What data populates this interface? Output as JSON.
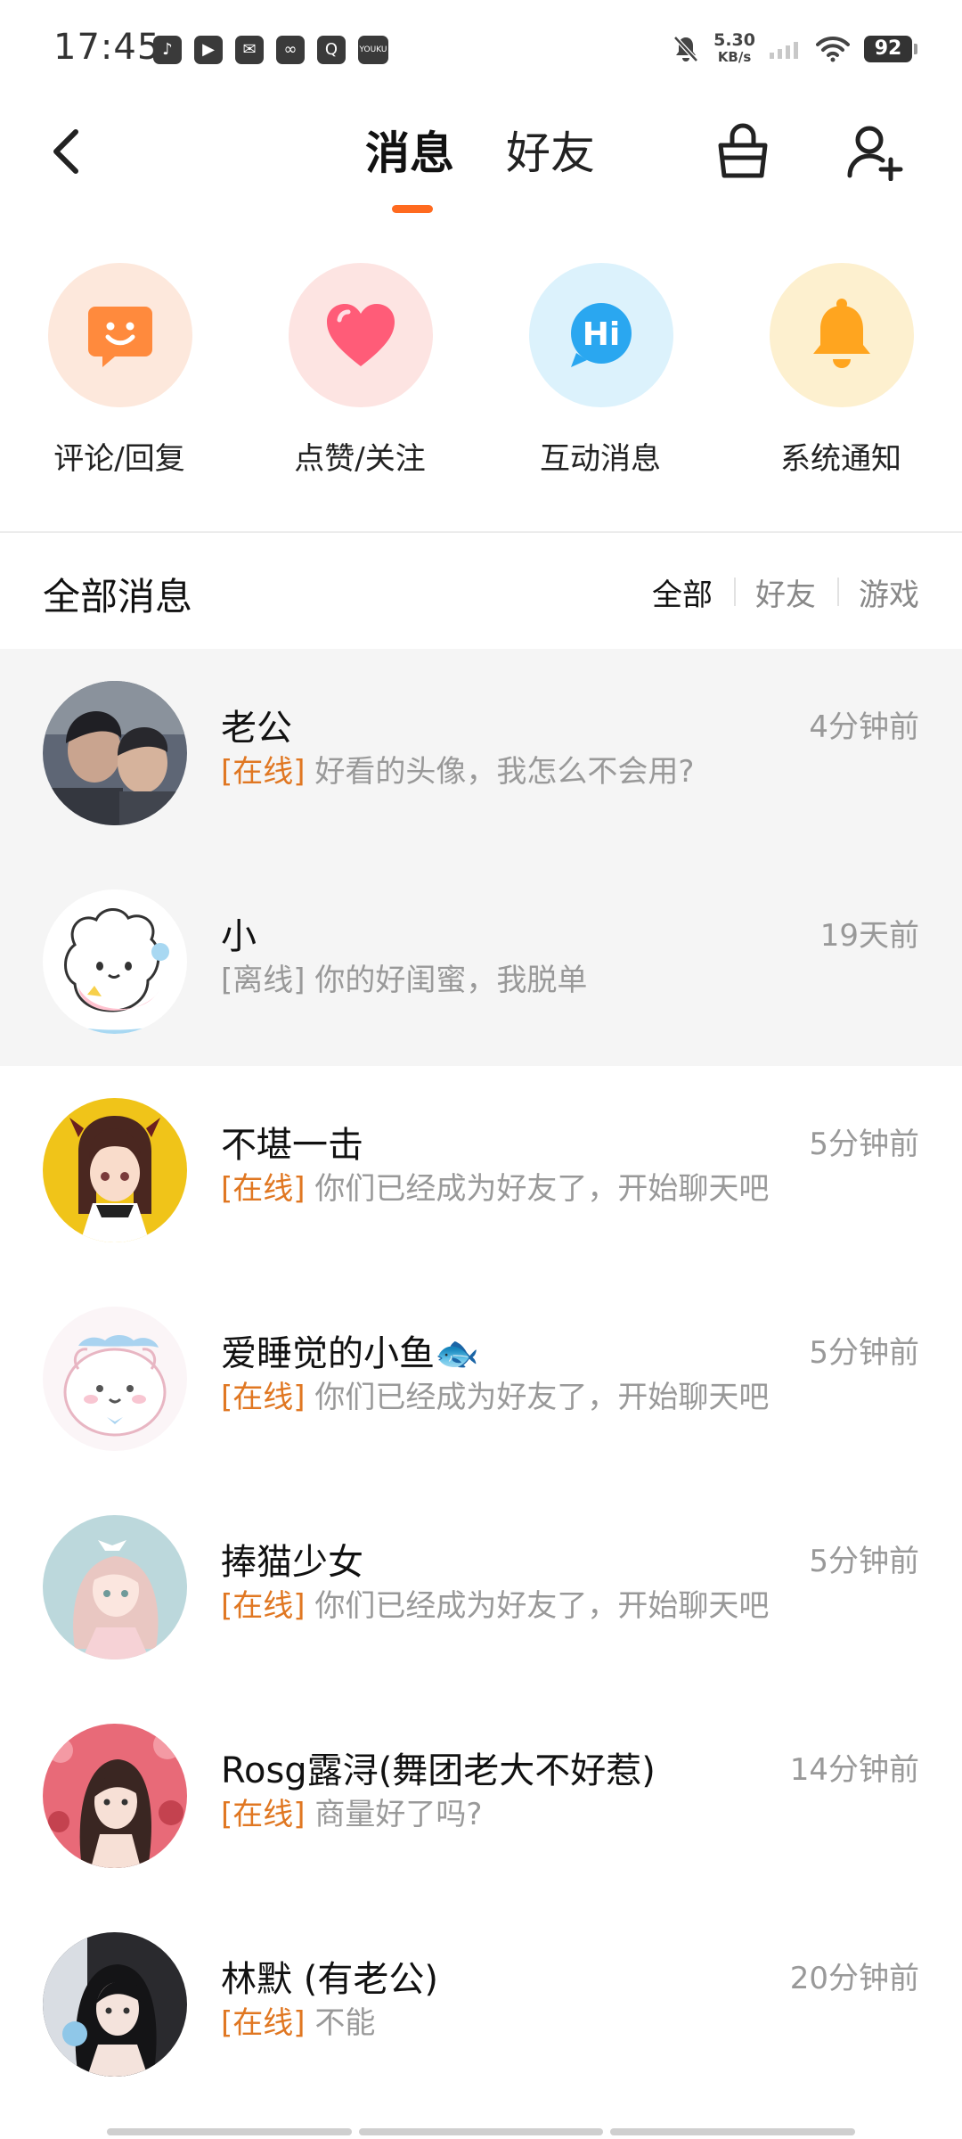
{
  "status_bar": {
    "time": "17:45",
    "app_icons": [
      "tiktok-icon",
      "play-icon",
      "mail-icon",
      "link-icon",
      "search-app-icon",
      "youku-icon"
    ],
    "net_speed_value": "5.30",
    "net_speed_unit": "KB/s",
    "battery": "92"
  },
  "header": {
    "tab_messages": "消息",
    "tab_friends": "好友",
    "accent_color": "#ff6a1f"
  },
  "categories": [
    {
      "label": "评论/回复",
      "icon": "smile-chat-icon",
      "bg": "#fde8dc",
      "color": "#ff8a3d"
    },
    {
      "label": "点赞/关注",
      "icon": "heart-icon",
      "bg": "#fde4e2",
      "color": "#ff5c78"
    },
    {
      "label": "互动消息",
      "icon": "hi-bubble-icon",
      "bg": "#dcf2fc",
      "color": "#2aa7f0",
      "hi_text": "Hi"
    },
    {
      "label": "系统通知",
      "icon": "bell-icon",
      "bg": "#fdf0cf",
      "color": "#ffa51f"
    }
  ],
  "section": {
    "title": "全部消息",
    "filters": [
      "全部",
      "好友",
      "游戏"
    ]
  },
  "messages": [
    {
      "name": "老公",
      "time": "4分钟前",
      "status": "[在线]",
      "preview": "好看的头像，我怎么不会用?"
    },
    {
      "name": "小",
      "time": "19天前",
      "status": "[离线]",
      "preview": "你的好闺蜜，我脱单"
    },
    {
      "name": "不堪一击",
      "time": "5分钟前",
      "status": "[在线]",
      "preview": "你们已经成为好友了，开始聊天吧"
    },
    {
      "name": "爱睡觉的小鱼🐟",
      "time": "5分钟前",
      "status": "[在线]",
      "preview": "你们已经成为好友了，开始聊天吧"
    },
    {
      "name": "捧猫少女",
      "time": "5分钟前",
      "status": "[在线]",
      "preview": "你们已经成为好友了，开始聊天吧"
    },
    {
      "name": "Rosg露浔(舞团老大不好惹)",
      "time": "14分钟前",
      "status": "[在线]",
      "preview": "商量好了吗?"
    },
    {
      "name": "林默 (有老公)",
      "time": "20分钟前",
      "status": "[在线]",
      "preview": "不能"
    }
  ]
}
